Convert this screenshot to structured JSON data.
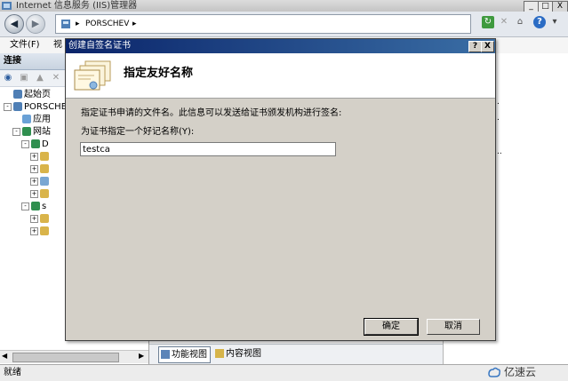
{
  "window": {
    "title": "Internet 信息服务 (IIS)管理器",
    "minimize": "_",
    "maximize": "□",
    "close": "X"
  },
  "address": {
    "separator": "▸",
    "node": "PORSCHEV",
    "dropdown": "▸",
    "help": "?"
  },
  "menu": {
    "file": "文件(F)",
    "view": "视"
  },
  "connections": {
    "header": "连接",
    "tree": [
      {
        "label": "起始页",
        "level": 1,
        "expander": ""
      },
      {
        "label": "PORSCHEV",
        "level": 1,
        "expander": "-"
      },
      {
        "label": "应用",
        "level": 2,
        "expander": ""
      },
      {
        "label": "网站",
        "level": 2,
        "expander": "-"
      },
      {
        "label": "D",
        "level": 3,
        "expander": "-"
      },
      {
        "label": "",
        "level": 4,
        "expander": "+"
      },
      {
        "label": "",
        "level": 4,
        "expander": "+"
      },
      {
        "label": "",
        "level": 4,
        "expander": "+"
      },
      {
        "label": "",
        "level": 4,
        "expander": "+"
      },
      {
        "label": "s",
        "level": 3,
        "expander": "-"
      },
      {
        "label": "",
        "level": 4,
        "expander": "+"
      },
      {
        "label": "",
        "level": 4,
        "expander": "+"
      }
    ]
  },
  "actions": {
    "items": [
      ".",
      ".",
      ".."
    ]
  },
  "view_tabs": {
    "features": "功能视图",
    "content": "内容视图"
  },
  "status": {
    "text": "就绪"
  },
  "watermark": {
    "text": "亿速云"
  },
  "dialog": {
    "title": "创建自签名证书",
    "help_button": "?",
    "close_button": "X",
    "heading": "指定友好名称",
    "description": "指定证书申请的文件名。此信息可以发送给证书颁发机构进行签名:",
    "name_label": "为证书指定一个好记名称(Y):",
    "name_value": "testca",
    "ok": "确定",
    "cancel": "取消"
  },
  "colors": {
    "dialog_title_start": "#0a246a",
    "dialog_title_end": "#3a6ea5",
    "dialog_body": "#d4d0c8"
  }
}
